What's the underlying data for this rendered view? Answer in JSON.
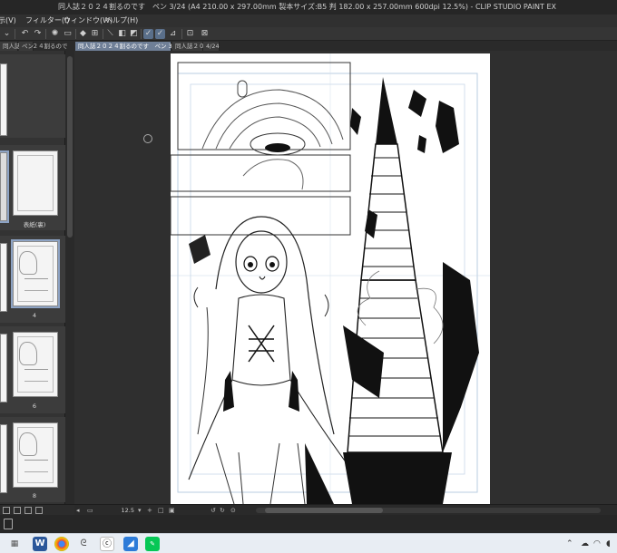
{
  "window": {
    "title": "同人誌２０２４割るのです　ペン 3/24 (A4 210.00 x 297.00mm 製本サイズ:B5 判 182.00 x 257.00mm 600dpi 12.5%) - CLIP STUDIO PAINT EX"
  },
  "menubar": {
    "items": [
      {
        "label": "示(V)"
      },
      {
        "label": "フィルター(I)"
      },
      {
        "label": "ウィンドウ(W)"
      },
      {
        "label": "ヘルプ(H)"
      }
    ]
  },
  "tabs": [
    {
      "label": "同人誌２０２４割るので"
    },
    {
      "label": "ペン"
    },
    {
      "label": "同人誌２０２４割るのです　ペン 3/24"
    },
    {
      "label": "同人誌２０"
    },
    {
      "label": "4/24"
    }
  ],
  "pages": {
    "label_cover_back": "表紙(裏)",
    "numbers": [
      "4",
      "6",
      "8"
    ]
  },
  "status": {
    "zoom": "12.5"
  },
  "colors": {
    "panel_bg": "#333333",
    "canvas_bg": "#2f2f2f",
    "tab_active": "#6f7f97",
    "taskbar_bg": "#e8edf3"
  },
  "taskbar": {
    "apps": [
      "start-icon",
      "word-icon",
      "chrome-icon",
      "edge-icon",
      "clip-studio-icon",
      "image-viewer-icon",
      "line-icon"
    ]
  }
}
